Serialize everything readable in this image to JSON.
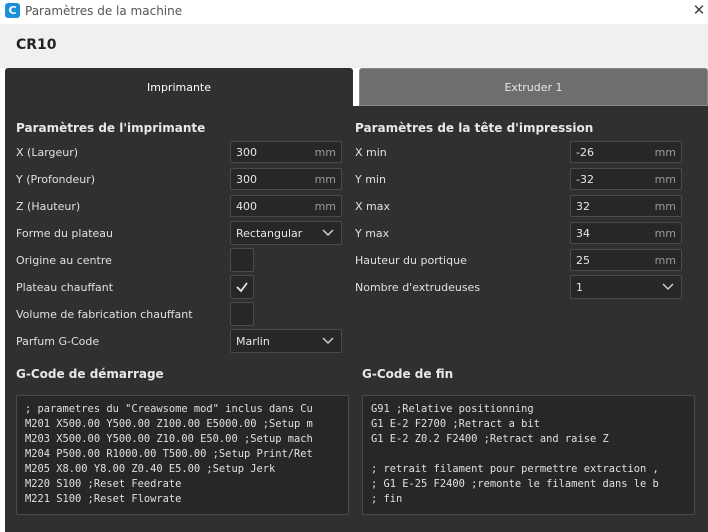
{
  "window": {
    "title": "Paramètres de la machine",
    "app_icon": "cura-logo-icon",
    "close_icon": "close-icon",
    "close_glyph": "✕"
  },
  "machine_name": "CR10",
  "tabs": [
    {
      "label": "Imprimante",
      "active": true
    },
    {
      "label": "Extruder 1",
      "active": false
    }
  ],
  "printer_settings": {
    "title": "Paramètres de l'imprimante",
    "x": {
      "label": "X (Largeur)",
      "value": "300",
      "unit": "mm"
    },
    "y": {
      "label": "Y (Profondeur)",
      "value": "300",
      "unit": "mm"
    },
    "z": {
      "label": "Z (Hauteur)",
      "value": "400",
      "unit": "mm"
    },
    "build_plate_shape": {
      "label": "Forme du plateau",
      "value": "Rectangular"
    },
    "origin_at_center": {
      "label": "Origine au centre",
      "checked": false
    },
    "heated_bed": {
      "label": "Plateau chauffant",
      "checked": true
    },
    "heated_build_volume": {
      "label": "Volume de fabrication chauffant",
      "checked": false
    },
    "gcode_flavor": {
      "label": "Parfum G-Code",
      "value": "Marlin"
    }
  },
  "printhead_settings": {
    "title": "Paramètres de la tête d'impression",
    "x_min": {
      "label": "X min",
      "value": "-26",
      "unit": "mm"
    },
    "y_min": {
      "label": "Y min",
      "value": "-32",
      "unit": "mm"
    },
    "x_max": {
      "label": "X max",
      "value": "32",
      "unit": "mm"
    },
    "y_max": {
      "label": "Y max",
      "value": "34",
      "unit": "mm"
    },
    "gantry_height": {
      "label": "Hauteur du portique",
      "value": "25",
      "unit": "mm"
    },
    "extruder_count": {
      "label": "Nombre d'extrudeuses",
      "value": "1"
    }
  },
  "start_gcode": {
    "title": "G-Code de démarrage",
    "lines": [
      "; parametres du \"Creawsome mod\" inclus dans Cu",
      "M201 X500.00 Y500.00 Z100.00 E5000.00 ;Setup m",
      "M203 X500.00 Y500.00 Z10.00 E50.00 ;Setup mach",
      "M204 P500.00 R1000.00 T500.00 ;Setup Print/Ret",
      "M205 X8.00 Y8.00 Z0.40 E5.00 ;Setup Jerk",
      "M220 S100 ;Reset Feedrate",
      "M221 S100 ;Reset Flowrate"
    ]
  },
  "end_gcode": {
    "title": "G-Code de fin",
    "lines": [
      "G91 ;Relative positionning",
      "G1 E-2 F2700 ;Retract a bit",
      "G1 E-2 Z0.2 F2400 ;Retract and raise Z",
      "",
      "; retrait filament pour permettre extraction ,",
      "; G1 E-25 F2400 ;remonte le filament dans le b",
      "; fin"
    ]
  },
  "colors": {
    "panel_bg": "#2f3032",
    "field_bg": "#262729",
    "inactive_tab": "#6e6e6e",
    "header_bg": "#f0f0f0"
  }
}
